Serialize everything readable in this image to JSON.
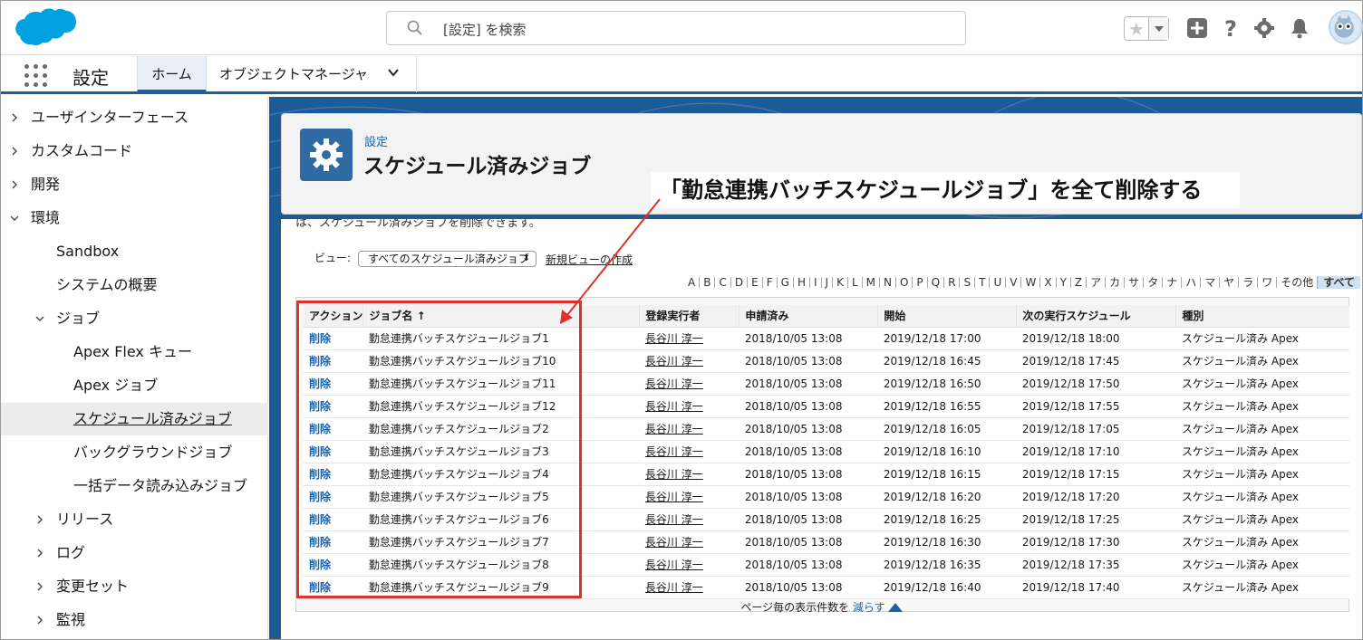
{
  "header": {
    "search_placeholder": "[設定] を検索",
    "icons": [
      "salesforce-cloud-logo",
      "search-icon",
      "star-icon",
      "add-icon",
      "help-icon",
      "setup-gear-icon",
      "notification-bell-icon",
      "avatar"
    ]
  },
  "nav": {
    "app_title": "設定",
    "tabs": [
      {
        "label": "ホーム"
      },
      {
        "label": "オブジェクトマネージャ"
      }
    ]
  },
  "sidebar": {
    "items": [
      {
        "label": "ユーザインターフェース"
      },
      {
        "label": "カスタムコード"
      },
      {
        "label": "開発"
      },
      {
        "label": "環境"
      },
      {
        "label": "Sandbox"
      },
      {
        "label": "システムの概要"
      },
      {
        "label": "ジョブ"
      },
      {
        "label": "Apex Flex キュー"
      },
      {
        "label": "Apex ジョブ"
      },
      {
        "label": "スケジュール済みジョブ"
      },
      {
        "label": "バックグラウンドジョブ"
      },
      {
        "label": "一括データ読み込みジョブ"
      },
      {
        "label": "リリース"
      },
      {
        "label": "ログ"
      },
      {
        "label": "変更セット"
      },
      {
        "label": "監視"
      }
    ]
  },
  "page": {
    "breadcrumb": "設定",
    "title": "スケジュール済みジョブ",
    "cutoff_text": "は、スケジュール済みジョブを削除できます。",
    "view_label": "ビュー:",
    "view_selected": "すべてのスケジュール済みジョブ",
    "new_view": "新規ビューの作成",
    "alphabet": [
      "A",
      "B",
      "C",
      "D",
      "E",
      "F",
      "G",
      "H",
      "I",
      "J",
      "K",
      "L",
      "M",
      "N",
      "O",
      "P",
      "Q",
      "R",
      "S",
      "T",
      "U",
      "V",
      "W",
      "X",
      "Y",
      "Z",
      "ア",
      "カ",
      "サ",
      "タ",
      "ナ",
      "ハ",
      "マ",
      "ヤ",
      "ラ",
      "ワ",
      "その他",
      "すべて"
    ],
    "pager_text": "ページ毎の表示件数を",
    "pager_link": "減らす"
  },
  "table": {
    "columns": [
      "アクション",
      "ジョブ名 ↑",
      "登録実行者",
      "申請済み",
      "開始",
      "次の実行スケジュール",
      "種別"
    ],
    "rows": [
      {
        "action": "削除",
        "name": "勤怠連携バッチスケジュールジョブ1",
        "owner": "長谷川 淳一",
        "submitted": "2018/10/05 13:08",
        "start": "2019/12/18 17:00",
        "next": "2019/12/18 18:00",
        "type": "スケジュール済み Apex"
      },
      {
        "action": "削除",
        "name": "勤怠連携バッチスケジュールジョブ10",
        "owner": "長谷川 淳一",
        "submitted": "2018/10/05 13:08",
        "start": "2019/12/18 16:45",
        "next": "2019/12/18 17:45",
        "type": "スケジュール済み Apex"
      },
      {
        "action": "削除",
        "name": "勤怠連携バッチスケジュールジョブ11",
        "owner": "長谷川 淳一",
        "submitted": "2018/10/05 13:08",
        "start": "2019/12/18 16:50",
        "next": "2019/12/18 17:50",
        "type": "スケジュール済み Apex"
      },
      {
        "action": "削除",
        "name": "勤怠連携バッチスケジュールジョブ12",
        "owner": "長谷川 淳一",
        "submitted": "2018/10/05 13:08",
        "start": "2019/12/18 16:55",
        "next": "2019/12/18 17:55",
        "type": "スケジュール済み Apex"
      },
      {
        "action": "削除",
        "name": "勤怠連携バッチスケジュールジョブ2",
        "owner": "長谷川 淳一",
        "submitted": "2018/10/05 13:08",
        "start": "2019/12/18 16:05",
        "next": "2019/12/18 17:05",
        "type": "スケジュール済み Apex"
      },
      {
        "action": "削除",
        "name": "勤怠連携バッチスケジュールジョブ3",
        "owner": "長谷川 淳一",
        "submitted": "2018/10/05 13:08",
        "start": "2019/12/18 16:10",
        "next": "2019/12/18 17:10",
        "type": "スケジュール済み Apex"
      },
      {
        "action": "削除",
        "name": "勤怠連携バッチスケジュールジョブ4",
        "owner": "長谷川 淳一",
        "submitted": "2018/10/05 13:08",
        "start": "2019/12/18 16:15",
        "next": "2019/12/18 17:15",
        "type": "スケジュール済み Apex"
      },
      {
        "action": "削除",
        "name": "勤怠連携バッチスケジュールジョブ5",
        "owner": "長谷川 淳一",
        "submitted": "2018/10/05 13:08",
        "start": "2019/12/18 16:20",
        "next": "2019/12/18 17:20",
        "type": "スケジュール済み Apex"
      },
      {
        "action": "削除",
        "name": "勤怠連携バッチスケジュールジョブ6",
        "owner": "長谷川 淳一",
        "submitted": "2018/10/05 13:08",
        "start": "2019/12/18 16:25",
        "next": "2019/12/18 17:25",
        "type": "スケジュール済み Apex"
      },
      {
        "action": "削除",
        "name": "勤怠連携バッチスケジュールジョブ7",
        "owner": "長谷川 淳一",
        "submitted": "2018/10/05 13:08",
        "start": "2019/12/18 16:30",
        "next": "2019/12/18 17:30",
        "type": "スケジュール済み Apex"
      },
      {
        "action": "削除",
        "name": "勤怠連携バッチスケジュールジョブ8",
        "owner": "長谷川 淳一",
        "submitted": "2018/10/05 13:08",
        "start": "2019/12/18 16:35",
        "next": "2019/12/18 17:35",
        "type": "スケジュール済み Apex"
      },
      {
        "action": "削除",
        "name": "勤怠連携バッチスケジュールジョブ9",
        "owner": "長谷川 淳一",
        "submitted": "2018/10/05 13:08",
        "start": "2019/12/18 16:40",
        "next": "2019/12/18 17:40",
        "type": "スケジュール済み Apex"
      }
    ]
  },
  "annotation": {
    "callout": "「勤怠連携バッチスケジュールジョブ」を全て削除する",
    "color": "#e0302a"
  },
  "colors": {
    "brand_blue": "#1b5f9e",
    "link_blue": "#1b62a8",
    "salesforce_cloud": "#00a1e0"
  }
}
